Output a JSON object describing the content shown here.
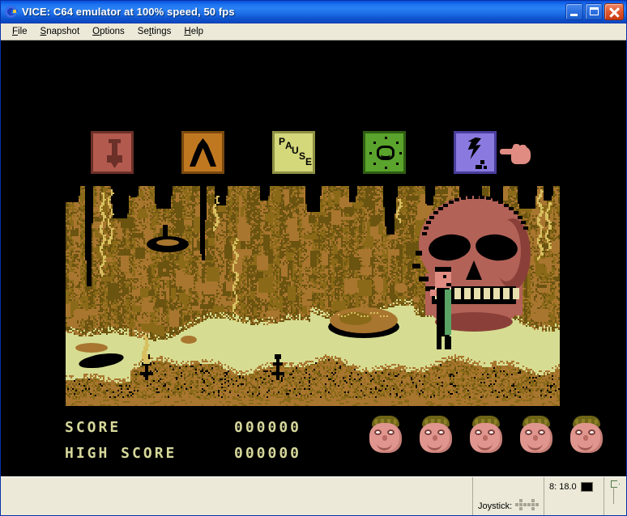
{
  "window": {
    "icon": "vice-commodore-logo-icon",
    "title": "VICE: C64 emulator at 100% speed, 50 fps",
    "buttons": {
      "minimize": "minimize-button",
      "maximize": "maximize-button",
      "close": "close-button"
    }
  },
  "menubar": {
    "items": [
      {
        "label": "File",
        "pre": "",
        "accel": "F",
        "post": "ile"
      },
      {
        "label": "Snapshot",
        "pre": "",
        "accel": "S",
        "post": "napshot"
      },
      {
        "label": "Options",
        "pre": "",
        "accel": "O",
        "post": "ptions"
      },
      {
        "label": "Settings",
        "pre": "Se",
        "accel": "t",
        "post": "tings"
      },
      {
        "label": "Help",
        "pre": "",
        "accel": "H",
        "post": "elp"
      }
    ]
  },
  "game": {
    "title_bar_icons": [
      {
        "name": "shovel-tool-icon",
        "label": "",
        "bg": "#b35a4e",
        "border": "#6b3028"
      },
      {
        "name": "tent-cave-icon",
        "label": "",
        "bg": "#c07820",
        "border": "#7a4a10"
      },
      {
        "name": "pause-icon",
        "label": "PAUSE",
        "bg": "#d4d77a",
        "border": "#8e9144"
      },
      {
        "name": "sun-orb-icon",
        "label": "",
        "bg": "#5aa32c",
        "border": "#2f5e14"
      },
      {
        "name": "lightning-crack-icon",
        "label": "",
        "bg": "#8a7ae0",
        "border": "#4a3e9c"
      }
    ],
    "pause_letters": [
      "P",
      "A",
      "U",
      "S",
      "E"
    ],
    "cursor": "pointing-hand-cursor",
    "score": {
      "score_label": "SCORE",
      "score_value": "000000",
      "high_score_label": "HIGH SCORE",
      "high_score_value": "000000"
    },
    "lives": {
      "count": 5,
      "icon": "player-head-life-icon"
    },
    "scene": {
      "description": "cave-interior-with-giant-skull",
      "colors": {
        "rock_dark": "#6b5310",
        "rock_mid": "#8a6a18",
        "rock_light": "#a9762f",
        "rock_highlight": "#d8c060",
        "black": "#000000",
        "floor": "#d6dd92",
        "skull": "#b36258",
        "skull_shadow": "#8a4038",
        "player_skin": "#e08c82",
        "player_body": "#000000",
        "player_cloak": "#5aa364"
      }
    }
  },
  "statusbar": {
    "joystick_label": "Joystick:",
    "joystick_ports": 2,
    "drive_label": "8: 18.0",
    "drive_led": "#000000",
    "tape_icon": "tape-flag-icon"
  }
}
